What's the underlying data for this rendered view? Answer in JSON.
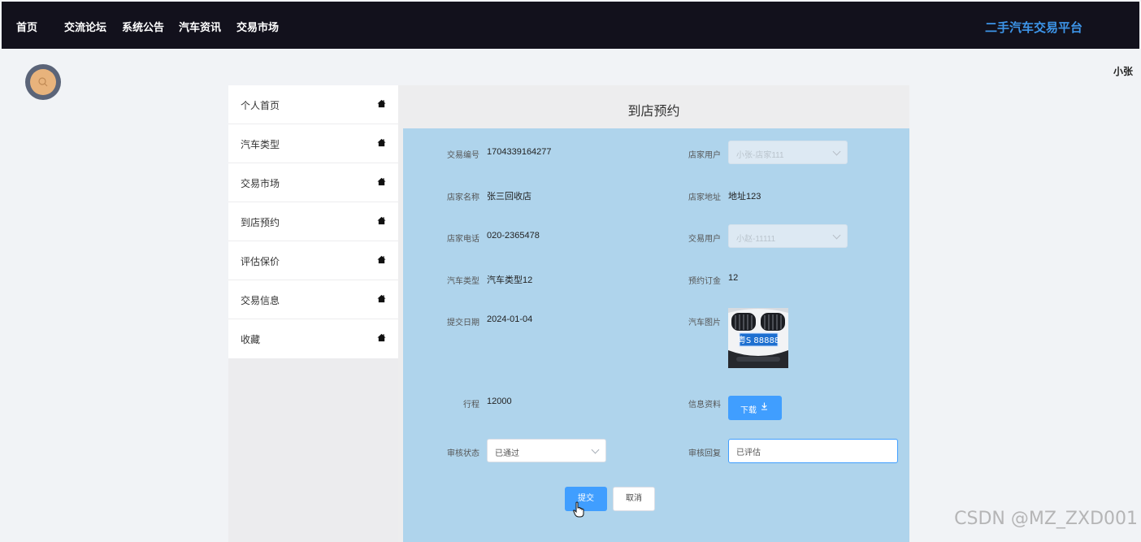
{
  "nav": {
    "items": [
      {
        "label": "首页"
      },
      {
        "label": "交流论坛"
      },
      {
        "label": "系统公告"
      },
      {
        "label": "汽车资讯"
      },
      {
        "label": "交易市场"
      }
    ],
    "site_title": "二手汽车交易平台"
  },
  "user": {
    "name": "小张"
  },
  "sidebar": {
    "items": [
      {
        "label": "个人首页",
        "icon": "home-icon"
      },
      {
        "label": "汽车类型",
        "icon": "home-icon"
      },
      {
        "label": "交易市场",
        "icon": "home-icon"
      },
      {
        "label": "到店预约",
        "icon": "home-icon"
      },
      {
        "label": "评估保价",
        "icon": "home-icon"
      },
      {
        "label": "交易信息",
        "icon": "home-icon"
      },
      {
        "label": "收藏",
        "icon": "home-icon"
      }
    ]
  },
  "page": {
    "title": "到店预约"
  },
  "form": {
    "trade_no": {
      "label": "交易编号",
      "value": "1704339164277"
    },
    "shop_user": {
      "label": "店家用户",
      "value": "小张-店家111"
    },
    "shop_name": {
      "label": "店家名称",
      "value": "张三回收店"
    },
    "shop_address": {
      "label": "店家地址",
      "value": "地址123"
    },
    "shop_phone": {
      "label": "店家电话",
      "value": "020-2365478"
    },
    "trade_user": {
      "label": "交易用户",
      "value": "小赵-11111"
    },
    "car_type": {
      "label": "汽车类型",
      "value": "汽车类型12"
    },
    "deposit": {
      "label": "预约订金",
      "value": "12"
    },
    "submit_date": {
      "label": "提交日期",
      "value": "2024-01-04"
    },
    "car_image": {
      "label": "汽车图片",
      "plate_text": "粤S 88888"
    },
    "mileage": {
      "label": "行程",
      "value": "12000"
    },
    "info": {
      "label": "信息资料",
      "button_label": "下载"
    },
    "review_status": {
      "label": "审核状态",
      "value": "已通过"
    },
    "review_reply": {
      "label": "审核回复",
      "value": "已评估"
    }
  },
  "actions": {
    "submit_label": "提交",
    "cancel_label": "取消"
  },
  "watermark": "CSDN @MZ_ZXD001",
  "colors": {
    "nav_bg": "#12111c",
    "accent": "#409eff",
    "panel_bg": "#afd4ec",
    "site_title": "#3d95e9"
  }
}
